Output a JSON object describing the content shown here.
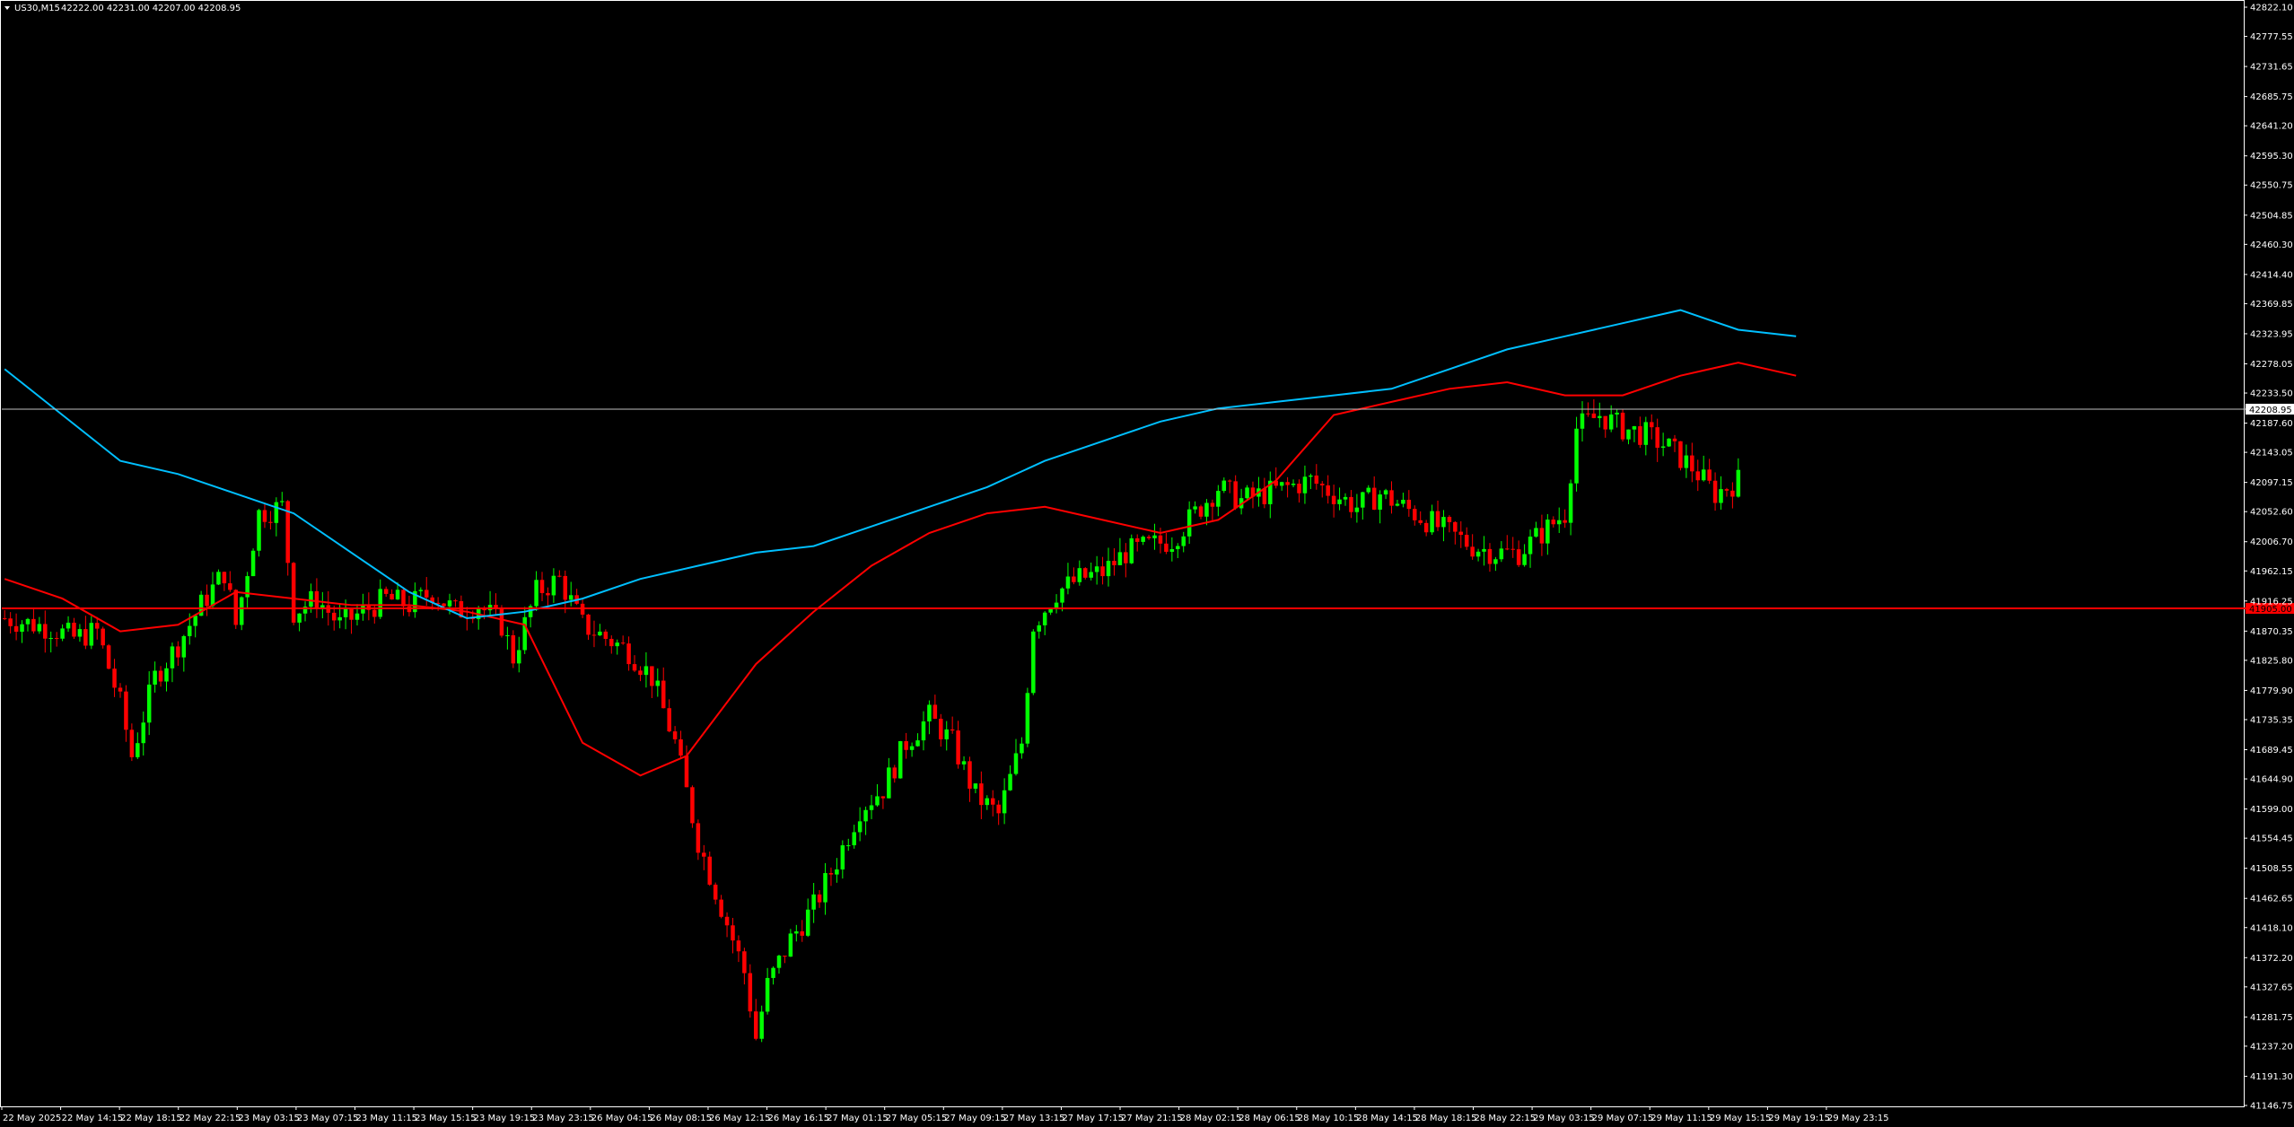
{
  "header": {
    "symbol_timeframe": "US30,M15",
    "ohlc": "42222.00 42231.00 42207.00 42208.95"
  },
  "colors": {
    "background": "#000000",
    "frame": "#ffffff",
    "bull_candle": "#00ff00",
    "bear_candle": "#ff0000",
    "ma_fast": "#ff0000",
    "ma_slow": "#00bfff",
    "bid_line": "#c0c0c0",
    "level_line": "#ff0000",
    "price_tag_bg": "#ffffff"
  },
  "chart_data": {
    "type": "candlestick",
    "ylim": [
      41146.75,
      42822.1
    ],
    "y_tick_labels": [
      "42822.10",
      "42777.55",
      "42731.65",
      "42685.75",
      "42641.20",
      "42595.30",
      "42550.75",
      "42504.85",
      "42460.30",
      "42414.40",
      "42369.85",
      "42323.95",
      "42278.05",
      "42233.50",
      "42187.60",
      "42143.05",
      "42097.15",
      "42052.60",
      "42006.70",
      "41962.15",
      "41916.25",
      "41870.35",
      "41825.80",
      "41779.90",
      "41735.35",
      "41689.45",
      "41644.90",
      "41599.00",
      "41554.45",
      "41508.55",
      "41462.65",
      "41418.10",
      "41372.20",
      "41327.65",
      "41281.75",
      "41237.20",
      "41191.30",
      "41146.75"
    ],
    "x_tick_labels": [
      "22 May 2025",
      "22 May 14:15",
      "22 May 18:15",
      "22 May 22:15",
      "23 May 03:15",
      "23 May 07:15",
      "23 May 11:15",
      "23 May 15:15",
      "23 May 19:15",
      "23 May 23:15",
      "26 May 04:15",
      "26 May 08:15",
      "26 May 12:15",
      "26 May 16:15",
      "27 May 01:15",
      "27 May 05:15",
      "27 May 09:15",
      "27 May 13:15",
      "27 May 17:15",
      "27 May 21:15",
      "28 May 02:15",
      "28 May 06:15",
      "28 May 10:15",
      "28 May 14:15",
      "28 May 18:15",
      "28 May 22:15",
      "29 May 03:15",
      "29 May 07:15",
      "29 May 11:15",
      "29 May 15:15",
      "29 May 19:15",
      "29 May 23:15"
    ],
    "current_price": 42208.95,
    "current_price_label": "42208.95",
    "horizontal_level": 41905,
    "horizontal_level_label": "41905.00",
    "bars_total": 310,
    "close_path": [
      [
        0,
        41890
      ],
      [
        8,
        41875
      ],
      [
        12,
        41860
      ],
      [
        16,
        41870
      ],
      [
        20,
        41760
      ],
      [
        22,
        41680
      ],
      [
        26,
        41800
      ],
      [
        30,
        41850
      ],
      [
        34,
        41910
      ],
      [
        38,
        41960
      ],
      [
        40,
        41880
      ],
      [
        44,
        42050
      ],
      [
        48,
        42060
      ],
      [
        50,
        41900
      ],
      [
        54,
        41920
      ],
      [
        58,
        41880
      ],
      [
        62,
        41900
      ],
      [
        66,
        41920
      ],
      [
        70,
        41910
      ],
      [
        74,
        41930
      ],
      [
        78,
        41900
      ],
      [
        82,
        41910
      ],
      [
        86,
        41880
      ],
      [
        88,
        41830
      ],
      [
        92,
        41930
      ],
      [
        96,
        41950
      ],
      [
        100,
        41880
      ],
      [
        104,
        41860
      ],
      [
        108,
        41840
      ],
      [
        112,
        41800
      ],
      [
        116,
        41700
      ],
      [
        120,
        41550
      ],
      [
        124,
        41450
      ],
      [
        128,
        41350
      ],
      [
        130,
        41250
      ],
      [
        132,
        41330
      ],
      [
        136,
        41400
      ],
      [
        140,
        41450
      ],
      [
        144,
        41520
      ],
      [
        148,
        41600
      ],
      [
        152,
        41630
      ],
      [
        156,
        41700
      ],
      [
        160,
        41740
      ],
      [
        164,
        41700
      ],
      [
        168,
        41620
      ],
      [
        172,
        41590
      ],
      [
        176,
        41700
      ],
      [
        178,
        41880
      ],
      [
        182,
        41930
      ],
      [
        186,
        41950
      ],
      [
        190,
        41960
      ],
      [
        194,
        41990
      ],
      [
        198,
        42000
      ],
      [
        202,
        42010
      ],
      [
        206,
        42050
      ],
      [
        210,
        42090
      ],
      [
        214,
        42070
      ],
      [
        218,
        42080
      ],
      [
        222,
        42090
      ],
      [
        226,
        42100
      ],
      [
        230,
        42080
      ],
      [
        234,
        42060
      ],
      [
        238,
        42080
      ],
      [
        242,
        42060
      ],
      [
        246,
        42040
      ],
      [
        250,
        42020
      ],
      [
        254,
        42000
      ],
      [
        258,
        41990
      ],
      [
        262,
        41990
      ],
      [
        266,
        42020
      ],
      [
        270,
        42050
      ],
      [
        272,
        42180
      ],
      [
        276,
        42200
      ],
      [
        280,
        42180
      ],
      [
        284,
        42170
      ],
      [
        288,
        42150
      ],
      [
        292,
        42120
      ],
      [
        296,
        42080
      ],
      [
        300,
        42100
      ]
    ],
    "series": [
      {
        "name": "",
        "type": "ma",
        "color": "#ff0000",
        "points": [
          [
            0,
            41950
          ],
          [
            10,
            41920
          ],
          [
            20,
            41870
          ],
          [
            30,
            41880
          ],
          [
            40,
            41930
          ],
          [
            50,
            41920
          ],
          [
            60,
            41910
          ],
          [
            70,
            41910
          ],
          [
            80,
            41900
          ],
          [
            90,
            41880
          ],
          [
            100,
            41700
          ],
          [
            110,
            41650
          ],
          [
            118,
            41680
          ],
          [
            130,
            41820
          ],
          [
            140,
            41900
          ],
          [
            150,
            41970
          ],
          [
            160,
            42020
          ],
          [
            170,
            42050
          ],
          [
            180,
            42060
          ],
          [
            190,
            42040
          ],
          [
            200,
            42020
          ],
          [
            210,
            42040
          ],
          [
            220,
            42100
          ],
          [
            230,
            42200
          ],
          [
            240,
            42220
          ],
          [
            250,
            42240
          ],
          [
            260,
            42250
          ],
          [
            270,
            42230
          ],
          [
            280,
            42230
          ],
          [
            290,
            42260
          ],
          [
            300,
            42280
          ],
          [
            310,
            42260
          ]
        ]
      },
      {
        "name": "",
        "type": "ma",
        "color": "#00bfff",
        "points": [
          [
            0,
            42270
          ],
          [
            10,
            42200
          ],
          [
            20,
            42130
          ],
          [
            30,
            42110
          ],
          [
            40,
            42080
          ],
          [
            50,
            42050
          ],
          [
            60,
            41990
          ],
          [
            70,
            41930
          ],
          [
            80,
            41890
          ],
          [
            90,
            41900
          ],
          [
            100,
            41920
          ],
          [
            110,
            41950
          ],
          [
            120,
            41970
          ],
          [
            130,
            41990
          ],
          [
            140,
            42000
          ],
          [
            150,
            42030
          ],
          [
            160,
            42060
          ],
          [
            170,
            42090
          ],
          [
            180,
            42130
          ],
          [
            190,
            42160
          ],
          [
            200,
            42190
          ],
          [
            210,
            42210
          ],
          [
            220,
            42220
          ],
          [
            230,
            42230
          ],
          [
            240,
            42240
          ],
          [
            250,
            42270
          ],
          [
            260,
            42300
          ],
          [
            270,
            42320
          ],
          [
            280,
            42340
          ],
          [
            290,
            42360
          ],
          [
            300,
            42330
          ],
          [
            310,
            42320
          ]
        ]
      }
    ]
  }
}
